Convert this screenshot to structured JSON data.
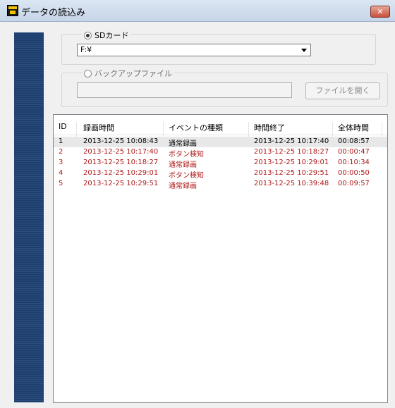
{
  "window": {
    "title": "データの読込み",
    "close_label": "✕"
  },
  "sd": {
    "label": "SDカード",
    "selected_drive": "F:¥"
  },
  "backup": {
    "label": "バックアップファイル",
    "path": "",
    "open_button": "ファイルを開く"
  },
  "table": {
    "headers": {
      "id": "ID",
      "rec_time": "録画時間",
      "event": "イベントの種類",
      "end_time": "時間終了",
      "total": "全体時間"
    },
    "rows": [
      {
        "id": "1",
        "rec_time": "2013-12-25 10:08:43",
        "event": "通常録画",
        "end_time": "2013-12-25 10:17:40",
        "total": "00:08:57"
      },
      {
        "id": "2",
        "rec_time": "2013-12-25 10:17:40",
        "event": "ボタン検知",
        "end_time": "2013-12-25 10:18:27",
        "total": "00:00:47"
      },
      {
        "id": "3",
        "rec_time": "2013-12-25 10:18:27",
        "event": "通常録画",
        "end_time": "2013-12-25 10:29:01",
        "total": "00:10:34"
      },
      {
        "id": "4",
        "rec_time": "2013-12-25 10:29:01",
        "event": "ボタン検知",
        "end_time": "2013-12-25 10:29:51",
        "total": "00:00:50"
      },
      {
        "id": "5",
        "rec_time": "2013-12-25 10:29:51",
        "event": "通常録画",
        "end_time": "2013-12-25 10:39:48",
        "total": "00:09:57"
      }
    ]
  },
  "colors": {
    "selected_row_text": "#000000",
    "row_text": "#b01818"
  }
}
